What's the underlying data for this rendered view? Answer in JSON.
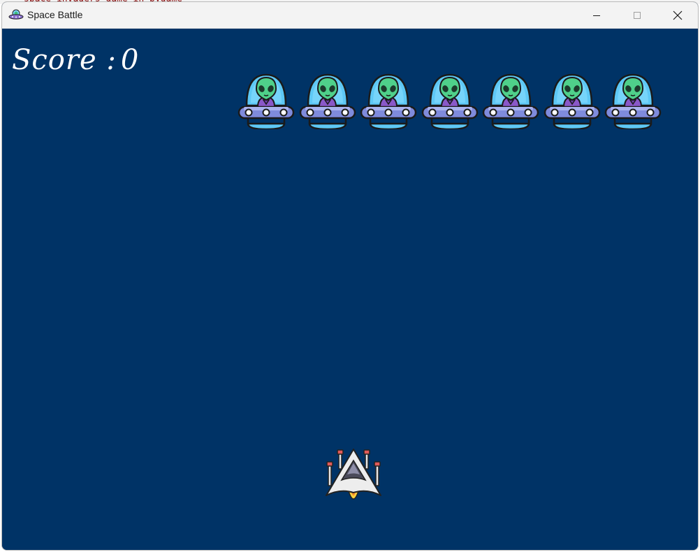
{
  "window": {
    "title": "Space Battle",
    "app_icon": "ufo-icon",
    "controls": {
      "minimize": "minimize-icon",
      "maximize": "maximize-icon",
      "close": "close-icon"
    }
  },
  "game": {
    "score_label": "Score :",
    "score_value": "0",
    "enemy_count": 7,
    "enemy_icon": "alien-ufo-icon",
    "player_icon": "spaceship-icon"
  },
  "colors": {
    "background": "#003366",
    "titlebar": "#f3f3f3",
    "score_text": "#ffffff"
  }
}
